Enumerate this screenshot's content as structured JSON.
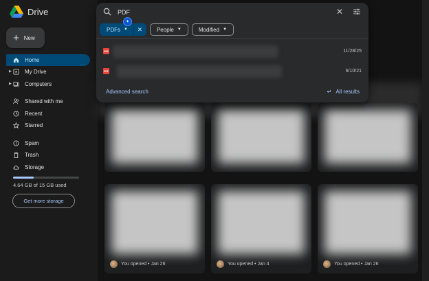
{
  "app": {
    "title": "Drive"
  },
  "sidebar": {
    "new_label": "New",
    "items": [
      {
        "label": "Home",
        "icon": "home-icon",
        "active": true
      },
      {
        "label": "My Drive",
        "icon": "drive-icon",
        "caret": true
      },
      {
        "label": "Computers",
        "icon": "computer-icon",
        "caret": true
      },
      {
        "label": "Shared with me",
        "icon": "people-icon"
      },
      {
        "label": "Recent",
        "icon": "clock-icon"
      },
      {
        "label": "Starred",
        "icon": "star-icon"
      },
      {
        "label": "Spam",
        "icon": "spam-icon"
      },
      {
        "label": "Trash",
        "icon": "trash-icon"
      },
      {
        "label": "Storage",
        "icon": "cloud-icon"
      }
    ],
    "storage": {
      "used_text": "4.64 GB of 15 GB used",
      "fraction": 0.31,
      "button": "Get more storage"
    }
  },
  "search": {
    "value": "PDF",
    "chips": [
      {
        "label": "PDFs",
        "selected": true
      },
      {
        "label": "People"
      },
      {
        "label": "Modified"
      }
    ],
    "results": [
      {
        "date": "11/28/25",
        "type": "PDF"
      },
      {
        "date": "6/10/21",
        "type": "PDF"
      }
    ],
    "advanced_label": "Advanced search",
    "all_results_label": "All results"
  },
  "cards": [
    {
      "footer": "You opened • Jan 26"
    },
    {
      "footer": "You opened • Jan 4"
    },
    {
      "footer": "You opened • Jan 26"
    }
  ],
  "colors": {
    "accent": "#a8c7fa",
    "active_bg": "#004a77",
    "pdf": "#e8453c"
  }
}
